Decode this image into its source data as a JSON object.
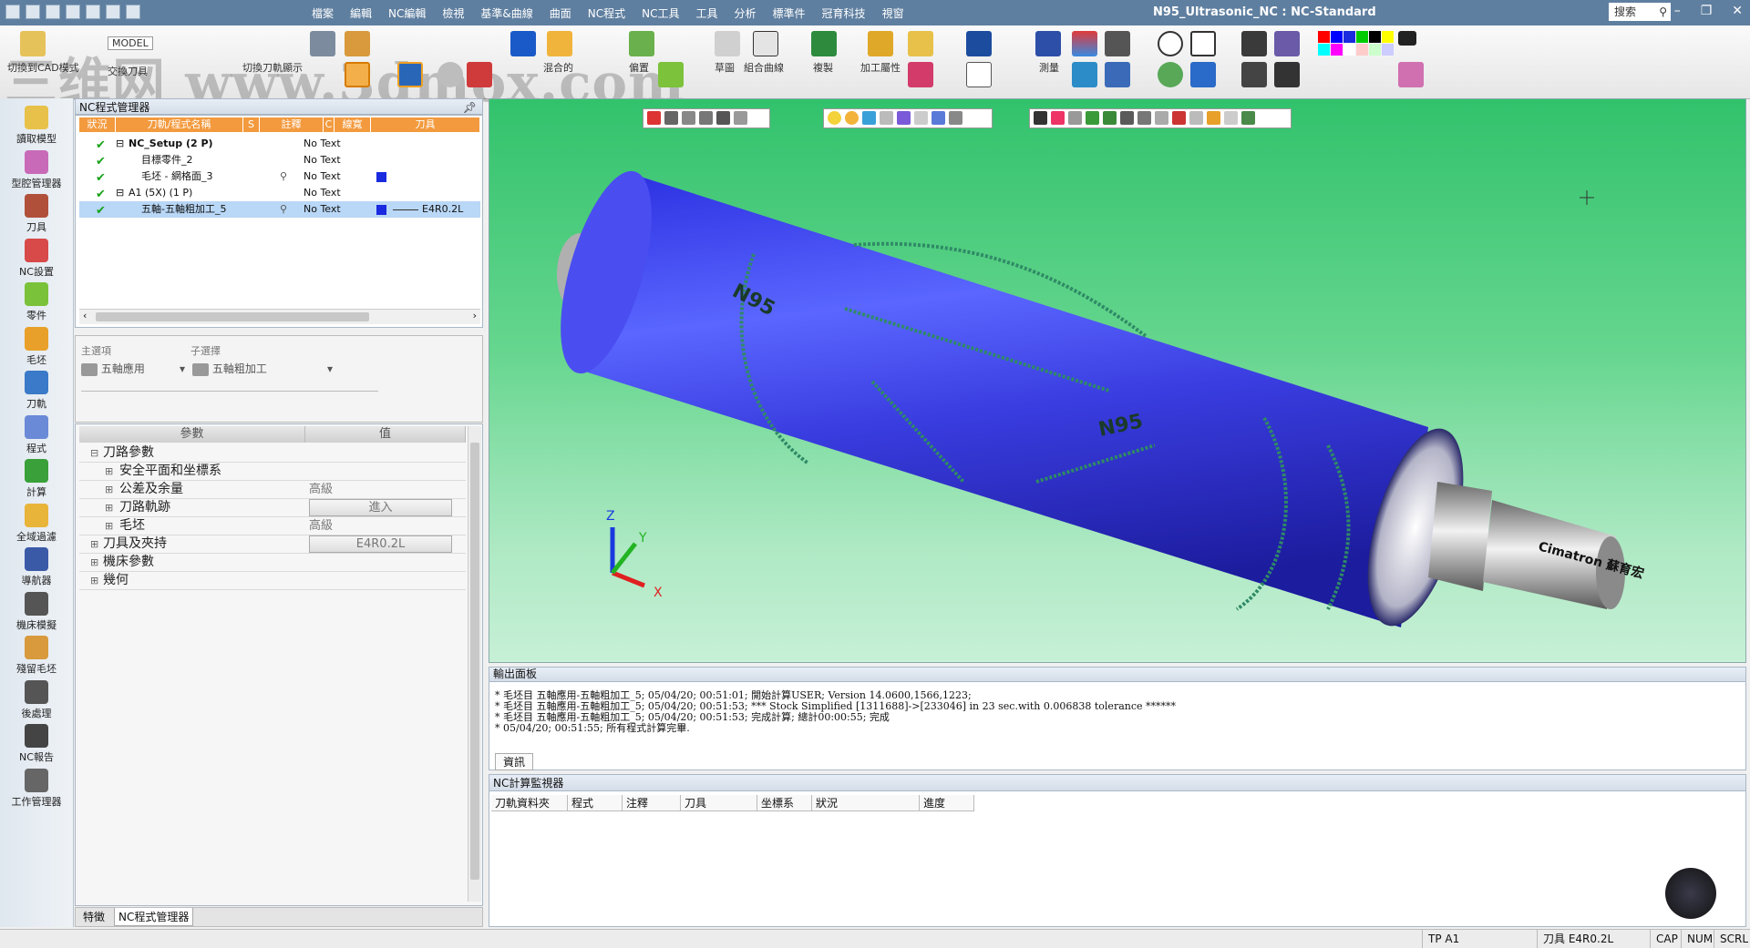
{
  "window": {
    "title": "N95_Ultrasonic_NC : NC-Standard",
    "search_placeholder": "搜索",
    "menu": [
      "檔案",
      "編輯",
      "NC編輯",
      "檢視",
      "基準&曲線",
      "曲面",
      "NC程式",
      "NC工具",
      "工具",
      "分析",
      "標準件",
      "冠育科技",
      "視窗"
    ]
  },
  "watermark": "三维网 www.3dmox.com",
  "ribbon": {
    "labels": {
      "switch_model": "切換到CAD模式",
      "model": "MODEL",
      "swap_tool": "交換刀具",
      "switch_tool_display": "切換刀軌顯示",
      "mixed": "混合的",
      "offset": "偏置",
      "sketch": "草圖",
      "composite_curve": "組合曲線",
      "copy": "複製",
      "machining_attr": "加工屬性",
      "measure": "測量"
    },
    "palette": [
      "#ff0000",
      "#0000ff",
      "#1a2adf",
      "#00cc00",
      "#000000",
      "#ffff00",
      "#00ffff",
      "#ff00ff",
      "#ffffff",
      "#ffcccc",
      "#ccffcc",
      "#ccccff"
    ]
  },
  "left_tools": [
    "讀取模型",
    "型腔管理器",
    "刀具",
    "NC設置",
    "零件",
    "毛坯",
    "刀軌",
    "程式",
    "計算",
    "全域過濾",
    "導航器",
    "機床模擬",
    "殘留毛坯",
    "後處理",
    "NC報告",
    "工作管理器"
  ],
  "nc_manager": {
    "title": "NC程式管理器",
    "columns": [
      "狀況",
      "刀軌/程式名稱",
      "S",
      "註釋",
      "C",
      "線寬",
      "刀具"
    ],
    "rows": [
      {
        "name": "NC_Setup (2 P)",
        "note": "No Text",
        "indent": 0,
        "expander": "⊟",
        "bold": true,
        "tool": ""
      },
      {
        "name": "目標零件_2",
        "note": "No Text",
        "indent": 1,
        "expander": "",
        "bold": false,
        "tool": ""
      },
      {
        "name": "毛坯 - 網格面_3",
        "note": "No Text",
        "indent": 1,
        "expander": "",
        "bold": false,
        "tool": "",
        "color": true
      },
      {
        "name": "A1 (5X) (1 P)",
        "note": "No Text",
        "indent": 0,
        "expander": "⊟",
        "bold": false,
        "tool": ""
      },
      {
        "name": "五軸-五軸粗加工_5",
        "note": "No Text",
        "indent": 1,
        "expander": "",
        "bold": false,
        "tool": "E4R0.2L",
        "color": true,
        "selected": true
      }
    ]
  },
  "selector": {
    "main_label": "主選項",
    "sub_label": "子選擇",
    "main_value": "五軸應用",
    "sub_value": "五軸粗加工"
  },
  "params": {
    "col_param": "參數",
    "col_value": "值",
    "rows": [
      {
        "name": "刀路參數",
        "value": "",
        "level": 0,
        "btn": false
      },
      {
        "name": "安全平面和坐標系",
        "value": "",
        "level": 1,
        "btn": false
      },
      {
        "name": "公差及余量",
        "value": "高級",
        "level": 1,
        "btn": false
      },
      {
        "name": "刀路軌跡",
        "value": "進入",
        "level": 1,
        "btn": true
      },
      {
        "name": "毛坯",
        "value": "高級",
        "level": 1,
        "btn": false
      },
      {
        "name": "刀具及夾持",
        "value": "E4R0.2L",
        "level": 0,
        "btn": true
      },
      {
        "name": "機床參數",
        "value": "",
        "level": 0,
        "btn": false
      },
      {
        "name": "幾何",
        "value": "",
        "level": 0,
        "btn": false
      }
    ]
  },
  "bottom_tabs": [
    "特徵",
    "NC程式管理器"
  ],
  "viewport": {
    "model_labels": [
      "N95",
      "N95",
      "Cimatron 蘇育宏"
    ],
    "axes": {
      "z": "Z",
      "y": "Y",
      "x": "X"
    }
  },
  "output": {
    "title": "輸出面板",
    "lines": [
      "* 毛坯目 五軸應用-五軸粗加工_5; 05/04/20; 00:51:01; 開始計算USER; Version 14.0600,1566,1223;",
      "* 毛坯目 五軸應用-五軸粗加工_5; 05/04/20; 00:51:53; *** Stock Simplified [1311688]->[233046] in 23 sec.with 0.006838 tolerance ******",
      "* 毛坯目 五軸應用-五軸粗加工_5; 05/04/20; 00:51:53; 完成計算; 總計00:00:55; 完成",
      "* 05/04/20; 00:51:55; 所有程式計算完畢."
    ],
    "tab": "資訊"
  },
  "monitor": {
    "title": "NC計算監視器",
    "columns": [
      "刀軌資料夾",
      "程式",
      "注釋",
      "刀具",
      "坐標系",
      "狀況",
      "進度"
    ]
  },
  "statusbar": {
    "tp": "TP A1",
    "tool": "刀具 E4R0.2L",
    "cap": "CAP",
    "num": "NUM",
    "scrl": "SCRL"
  }
}
